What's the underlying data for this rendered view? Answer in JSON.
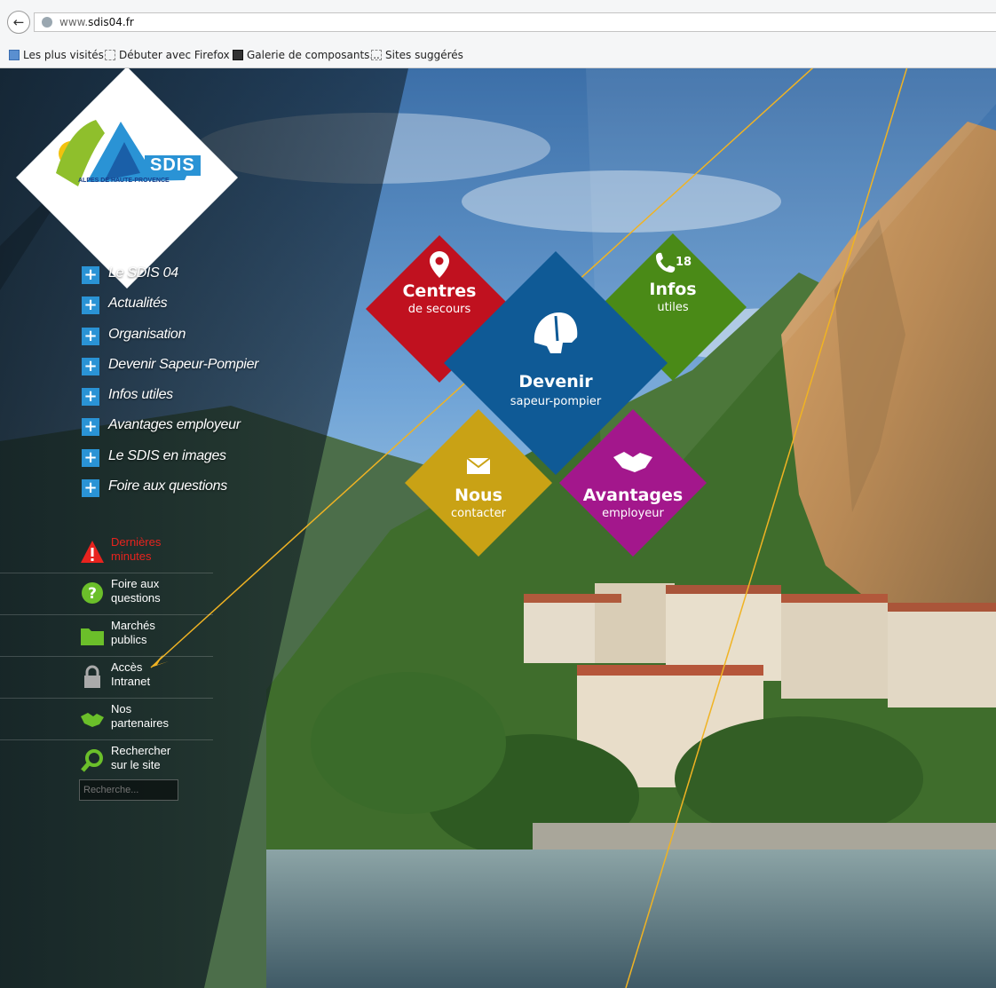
{
  "browser": {
    "url_prefix": "www.",
    "url_domain": "sdis04.fr",
    "bookmarks": [
      "Les plus visités",
      "Débuter avec Firefox",
      "Galerie de composants...",
      "Sites suggérés"
    ]
  },
  "logo": {
    "brand": "SDIS",
    "subtitle": "ALPES DE HAUTE-PROVENCE"
  },
  "menu": {
    "items": [
      {
        "label": "Le SDIS 04"
      },
      {
        "label": "Actualités"
      },
      {
        "label": "Organisation"
      },
      {
        "label": "Devenir Sapeur-Pompier"
      },
      {
        "label": "Infos utiles"
      },
      {
        "label": "Avantages employeur"
      },
      {
        "label": "Le SDIS en images"
      },
      {
        "label": "Foire aux questions"
      }
    ]
  },
  "quick_links": [
    {
      "line1": "Dernières",
      "line2": "minutes",
      "icon": "alert-icon"
    },
    {
      "line1": "Foire aux",
      "line2": "questions",
      "icon": "question-icon"
    },
    {
      "line1": "Marchés",
      "line2": "publics",
      "icon": "folder-icon"
    },
    {
      "line1": "Accès",
      "line2": "Intranet",
      "icon": "lock-icon"
    },
    {
      "line1": "Nos",
      "line2": "partenaires",
      "icon": "handshake-icon"
    },
    {
      "line1": "Rechercher",
      "line2": "sur le site",
      "icon": "search-icon"
    }
  ],
  "search": {
    "placeholder": "Recherche..."
  },
  "tiles": {
    "centres": {
      "title": "Centres",
      "sub": "de secours",
      "color": "#c0111f"
    },
    "infos": {
      "title": "Infos",
      "sub": "utiles",
      "badge": "18",
      "color": "#4a8a17"
    },
    "devenir": {
      "title": "Devenir",
      "sub": "sapeur-pompier",
      "color": "#0f5a96"
    },
    "nous": {
      "title": "Nous",
      "sub": "contacter",
      "color": "#c9a215"
    },
    "avantages": {
      "title": "Avantages",
      "sub": "employeur",
      "color": "#a3178c"
    }
  },
  "colors": {
    "accent": "#2a93d5",
    "alert": "#e8231e",
    "annotation": "#f0b323"
  }
}
